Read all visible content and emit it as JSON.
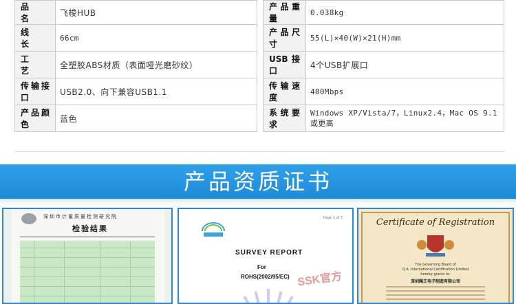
{
  "spec_table": {
    "rows": [
      {
        "label1": "品　　名",
        "value1": "飞梭HUB",
        "label2": "产品重量",
        "value2": "0.038kg"
      },
      {
        "label1": "线　　长",
        "value1": "66cm",
        "label2": "产品尺寸",
        "value2": "55(L)×40(W)×21(H)mm"
      },
      {
        "label1": "工　　艺",
        "value1": "全塑胶ABS材质（表面哑光磨砂纹）",
        "label2": "USB接口",
        "value2": "4个USB扩展口"
      },
      {
        "label1": "传输接口",
        "value1": "USB2.0、向下兼容USB1.1",
        "label2": "传输速度",
        "value2": "480Mbps"
      },
      {
        "label1": "产品颜色",
        "value1": "蓝色",
        "label2": "系统要求",
        "value2": "Windows XP/Vista/7，Linux2.4，Mac OS 9.1或更高"
      }
    ]
  },
  "banner": {
    "title": "产品资质证书"
  },
  "certificates": {
    "cert1": {
      "header": "深圳市计量质量检测研究院",
      "title": "检验结果"
    },
    "cert2": {
      "page_num": "Page 1 of 7",
      "survey": "SURVEY  REPORT",
      "for": "For",
      "rohs": "ROHS(2002/95/EC)",
      "stamp": "SSK官方"
    },
    "cert3": {
      "title": "Certificate of Registration",
      "line1": "The Governing Board of",
      "line2": "Q.A. International Certification Limited",
      "line3": "hereby grants to:",
      "company": "深圳飚王电子制造有限公司"
    }
  },
  "colors": {
    "banner_blue": "#2196e3",
    "panel_border": "#2e86d6"
  }
}
